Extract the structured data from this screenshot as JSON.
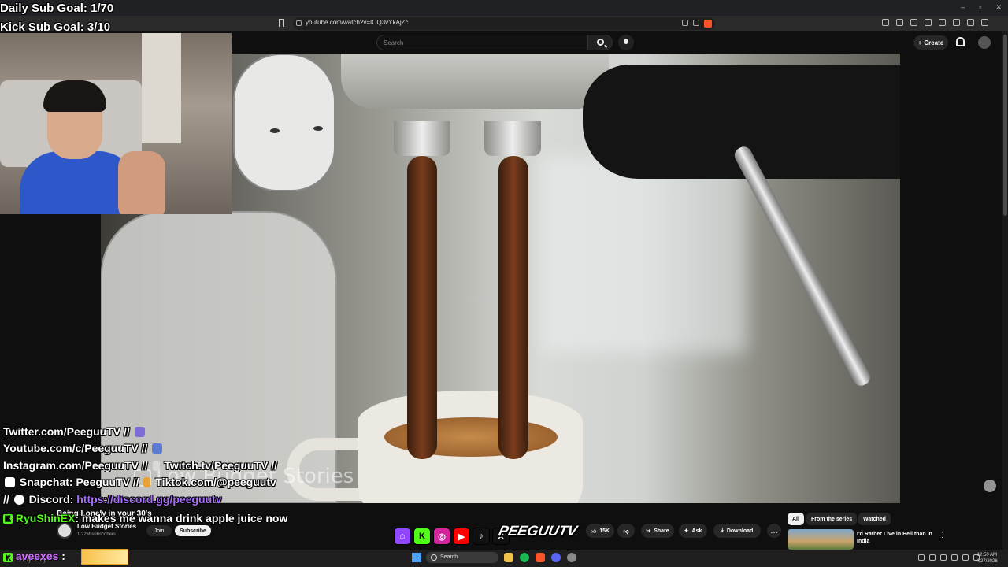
{
  "browser": {
    "url": "youtube.com/watch?v=IOQ3vYkAjZc",
    "window_controls": [
      "–",
      "▫",
      "✕"
    ]
  },
  "youtube": {
    "search_placeholder": "Search",
    "create_label": "Create",
    "video": {
      "title": "Being Lonely in your 30's",
      "watermark": "Low Budget Stories",
      "channel_name": "Low Budget Stories",
      "subscribers": "1.22M subscribers",
      "join_label": "Join",
      "subscribe_label": "Subscribe",
      "likes": "15K",
      "share_label": "Share",
      "ask_label": "Ask",
      "download_label": "Download",
      "more_label": "…"
    },
    "chips": [
      "All",
      "From the series",
      "Watched"
    ],
    "recommendation": {
      "title": "I'd Rather Live in Hell than in India",
      "more": "⋮"
    }
  },
  "stream_overlay": {
    "daily_sub_goal": "Daily Sub Goal: 1/70",
    "kick_sub_goal": "Kick Sub Goal: 3/10",
    "socials": [
      {
        "text": "Twitter.com/PeeguuTV //"
      },
      {
        "text": "Youtube.com/c/PeeguuTV //"
      },
      {
        "text": "Instagram.com/PeeguuTV //",
        "text2": "Twitch.tv/PeeguuTV //"
      },
      {
        "text": "Snapchat: PeeguuTV //",
        "text2": "Tiktok.com/@peeguutv"
      },
      {
        "text": "//",
        "text2": "Discord:",
        "link": "https://discord.gg/peeguutv"
      }
    ],
    "chat": [
      {
        "badge": "K",
        "user": "RyuShinEX",
        "message": ": makes me wanna drink apple juice now"
      },
      {
        "badge": "K",
        "user": "aveexes",
        "message": " :"
      }
    ],
    "brand_logo": "PEEGUUTV",
    "brand_icons": [
      "twitch",
      "kick",
      "instagram",
      "youtube",
      "tiktok",
      "x"
    ]
  },
  "taskbar": {
    "weather": "Mostly cloudy",
    "search_label": "Search",
    "time": "12:50 AM",
    "date": "4/27/2026"
  },
  "colors": {
    "kick_green": "#53fc18",
    "twitch_purple": "#a970ff",
    "youtube_red": "#ff0000"
  }
}
